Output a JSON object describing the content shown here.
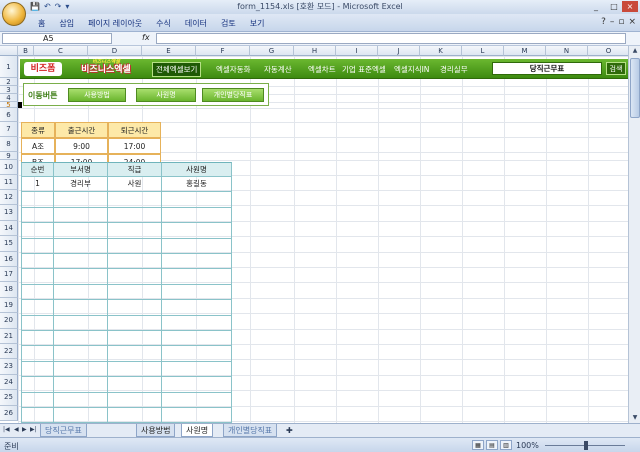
{
  "window": {
    "title": "form_1154.xls  [호환 모드]  -  Microsoft Excel",
    "controls": [
      "_",
      "□",
      "×"
    ]
  },
  "ribbon": {
    "tabs": [
      "홈",
      "삽입",
      "페이지 레이아웃",
      "수식",
      "데이터",
      "검토",
      "보기"
    ]
  },
  "formula_bar": {
    "name_box": "A5",
    "fx": "fx",
    "formula": ""
  },
  "columns": [
    "B",
    "C",
    "D",
    "E",
    "F",
    "G",
    "H",
    "I",
    "J",
    "K",
    "L",
    "M",
    "N",
    "O"
  ],
  "rows": [
    "1",
    "2",
    "3",
    "4",
    "5",
    "6",
    "7",
    "8",
    "9",
    "10",
    "11",
    "12",
    "13",
    "14",
    "15",
    "16",
    "17",
    "18",
    "19",
    "20",
    "21",
    "22",
    "23",
    "24",
    "25",
    "26"
  ],
  "banner": {
    "logo_left": "비즈폼",
    "logo_tag": "비즈니스엑셀",
    "logo_right": "비즈니스엑셀",
    "menu": [
      "전체엑셀보기",
      "엑셀자동화",
      "자동계산",
      "엑셀차트",
      "기업 표준엑셀",
      "엑셀지식IN",
      "경리실무"
    ],
    "search_value": "당직근무표",
    "search_button": "검색"
  },
  "shortcuts": {
    "label": "이동버튼",
    "buttons": [
      "사용방법",
      "사원명",
      "개인별당직표"
    ]
  },
  "shift_table": {
    "headers": [
      "종류",
      "출근시간",
      "퇴근시간"
    ],
    "rows": [
      [
        "A조",
        "9:00",
        "17:00"
      ],
      [
        "B조",
        "17:00",
        "24:00"
      ]
    ]
  },
  "main_table": {
    "headers": [
      "순번",
      "부서명",
      "직급",
      "사원명"
    ],
    "rows": [
      [
        "1",
        "경리부",
        "사원",
        "홍길동"
      ]
    ]
  },
  "sheet_tabs": [
    "당직근무표",
    "사용방법",
    "사원명",
    "개인별당직표"
  ],
  "sheet_nav": [
    "|◀",
    "◀",
    "▶",
    "▶|"
  ],
  "status": {
    "ready": "준비",
    "zoom": "100%"
  }
}
